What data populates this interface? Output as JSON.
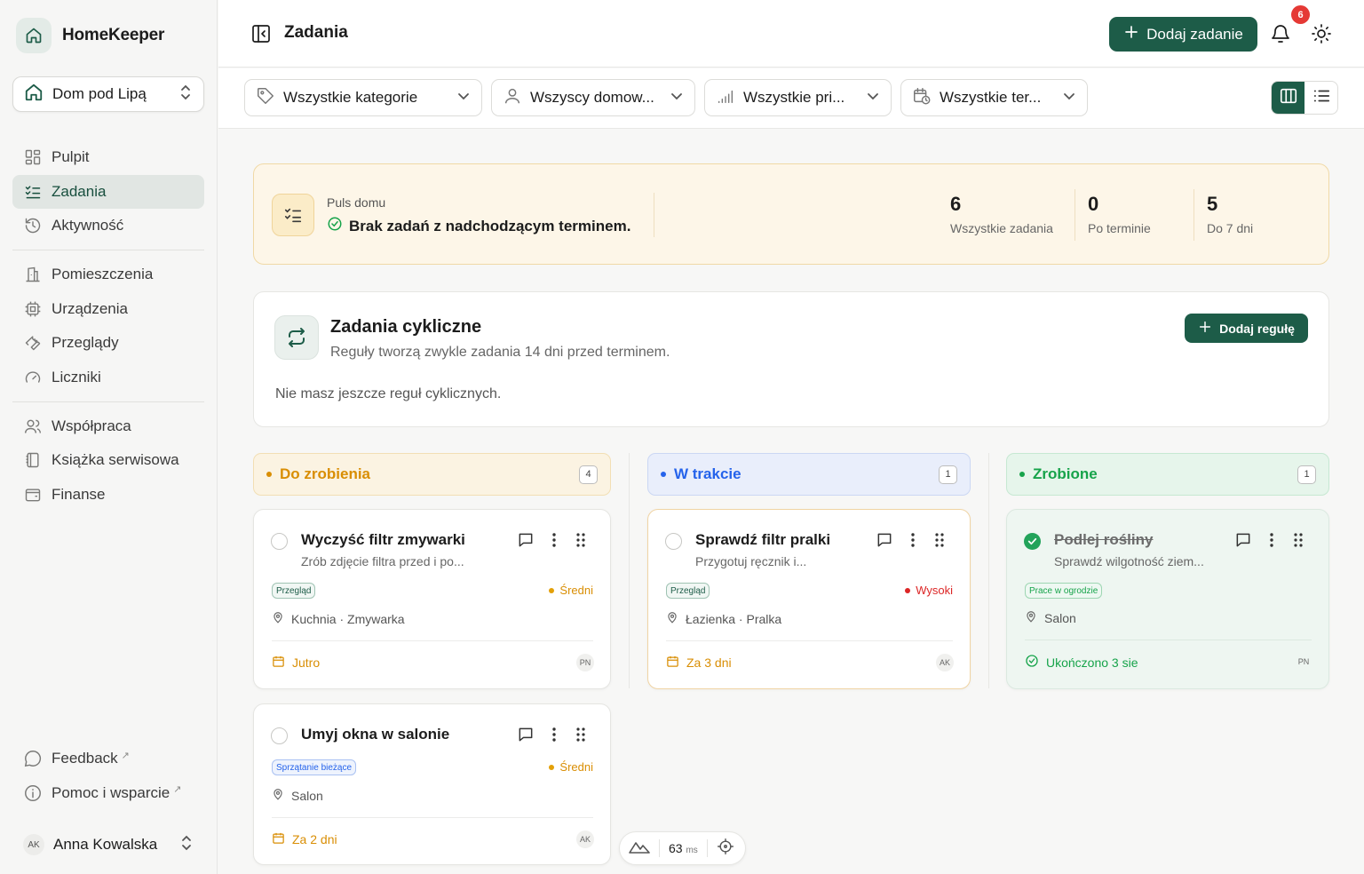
{
  "app": {
    "name": "HomeKeeper",
    "home_selector": "Dom pod Lipą"
  },
  "sidebar": {
    "groups": [
      [
        {
          "label": "Pulpit",
          "icon": "grid-icon"
        },
        {
          "label": "Zadania",
          "icon": "tasks-icon",
          "active": true
        },
        {
          "label": "Aktywność",
          "icon": "history-icon"
        }
      ],
      [
        {
          "label": "Pomieszczenia",
          "icon": "building-icon"
        },
        {
          "label": "Urządzenia",
          "icon": "chip-icon"
        },
        {
          "label": "Przeglądy",
          "icon": "wrench-icon"
        },
        {
          "label": "Liczniki",
          "icon": "gauge-icon"
        }
      ],
      [
        {
          "label": "Współpraca",
          "icon": "users-icon"
        },
        {
          "label": "Książka serwisowa",
          "icon": "book-icon"
        },
        {
          "label": "Finanse",
          "icon": "wallet-icon"
        }
      ]
    ],
    "footer": [
      {
        "label": "Feedback",
        "icon": "chat-icon",
        "external": true
      },
      {
        "label": "Pomoc i wsparcie",
        "icon": "info-icon",
        "external": true
      }
    ],
    "user": {
      "initials": "AK",
      "name": "Anna Kowalska"
    }
  },
  "topbar": {
    "title": "Zadania",
    "add_task_label": "Dodaj zadanie",
    "notification_count": "6"
  },
  "filters": [
    {
      "label": "Wszystkie kategorie",
      "icon": "tag-icon"
    },
    {
      "label": "Wszyscy domow...",
      "icon": "user-icon"
    },
    {
      "label": "Wszystkie pri...",
      "icon": "signal-icon"
    },
    {
      "label": "Wszystkie ter...",
      "icon": "calendar-clock-icon"
    }
  ],
  "pulse": {
    "label": "Puls domu",
    "message": "Brak zadań z nadchodzącym terminem.",
    "stats": [
      {
        "value": "6",
        "label": "Wszystkie zadania"
      },
      {
        "value": "0",
        "label": "Po terminie"
      },
      {
        "value": "5",
        "label": "Do 7 dni"
      }
    ]
  },
  "cyclic": {
    "title": "Zadania cykliczne",
    "subtitle": "Reguły tworzą zwykle zadania 14 dni przed terminem.",
    "empty": "Nie masz jeszcze reguł cyklicznych.",
    "add_rule_label": "Dodaj regułę"
  },
  "columns": [
    {
      "title": "Do zrobienia",
      "count": "4",
      "color": "#d98e04",
      "bg": "#fbf3e2",
      "border": "#f2dfb4",
      "cards": [
        {
          "title": "Wyczyść filtr zmywarki",
          "desc": "Zrób zdjęcie filtra przed i po...",
          "tag": "Przegląd",
          "priority": "Średni",
          "location": "Kuchnia · Zmywarka",
          "due": "Jutro",
          "assignee": "PN"
        },
        {
          "title": "Umyj okna w salonie",
          "desc": "",
          "tag": "Sprzątanie bieżące",
          "priority": "Średni",
          "location": "Salon",
          "due": "Za 2 dni",
          "assignee": "AK"
        }
      ]
    },
    {
      "title": "W trakcie",
      "count": "1",
      "color": "#2563eb",
      "bg": "#e9eefb",
      "border": "#cbd7f3",
      "cards": [
        {
          "title": "Sprawdź filtr pralki",
          "desc": "Przygotuj ręcznik i...",
          "tag": "Przegląd",
          "priority": "Wysoki",
          "location": "Łazienka · Pralka",
          "due": "Za 3 dni",
          "assignee": "AK"
        }
      ]
    },
    {
      "title": "Zrobione",
      "count": "1",
      "color": "#16a34a",
      "bg": "#e6f5eb",
      "border": "#c6e8d2",
      "cards": [
        {
          "title": "Podlej rośliny",
          "desc": "Sprawdź wilgotność ziem...",
          "tag": "Prace w ogrodzie",
          "priority": "",
          "location": "Salon",
          "due": "Ukończono 3 sie",
          "assignee": "PN"
        }
      ]
    }
  ],
  "perf": {
    "value": "63",
    "unit": "ms"
  }
}
